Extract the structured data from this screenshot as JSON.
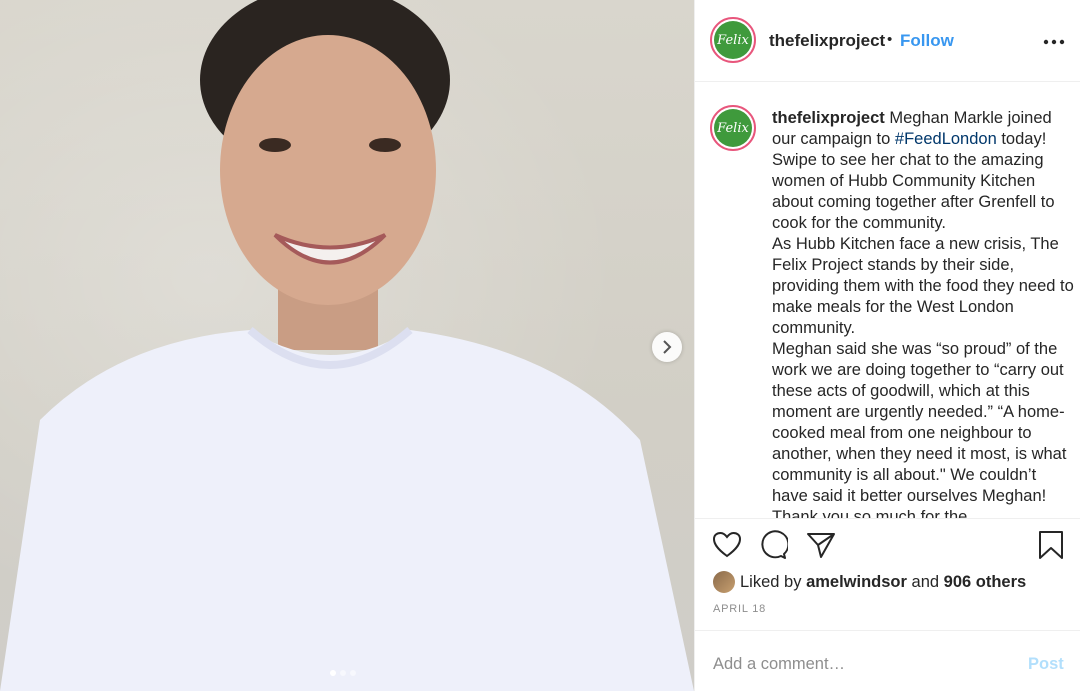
{
  "post": {
    "username": "thefelixproject",
    "avatar_text": "Felix",
    "separator": "•",
    "follow_label": "Follow",
    "more_label": "•••"
  },
  "caption": {
    "username": "thefelixproject",
    "part1": " Meghan Markle joined our campaign to ",
    "hashtag": "#FeedLondon",
    "part2": " today! Swipe to see her chat to the amazing women of Hubb Community Kitchen about coming together after Grenfell to cook for the community.",
    "para2": "As Hubb Kitchen face a new crisis, The Felix Project stands by their side, providing them with the food they need to make meals for the West London community.",
    "para3": "Meghan said she was “so proud” of the work we are doing together to “carry out these acts of goodwill, which at this moment are urgently needed.” “A home-cooked meal from one neighbour to another, when they need it most, is what community is all about.\" We couldn’t have said it better ourselves Meghan! Thank you so much for the"
  },
  "likes": {
    "prefix": "Liked by ",
    "user": "amelwindsor",
    "middle": " and ",
    "count": "906 others"
  },
  "date": "APRIL 18",
  "comment": {
    "placeholder": "Add a comment…",
    "post_label": "Post"
  },
  "icons": {
    "like": "heart-icon",
    "comment": "comment-icon",
    "share": "share-icon",
    "save": "bookmark-icon",
    "next": "chevron-right-icon"
  },
  "colors": {
    "link": "#3897f0",
    "hashtag": "#00376b",
    "muted": "#8e8e8e",
    "story_ring": "#e8567c",
    "avatar_bg": "#3f9a3c"
  }
}
